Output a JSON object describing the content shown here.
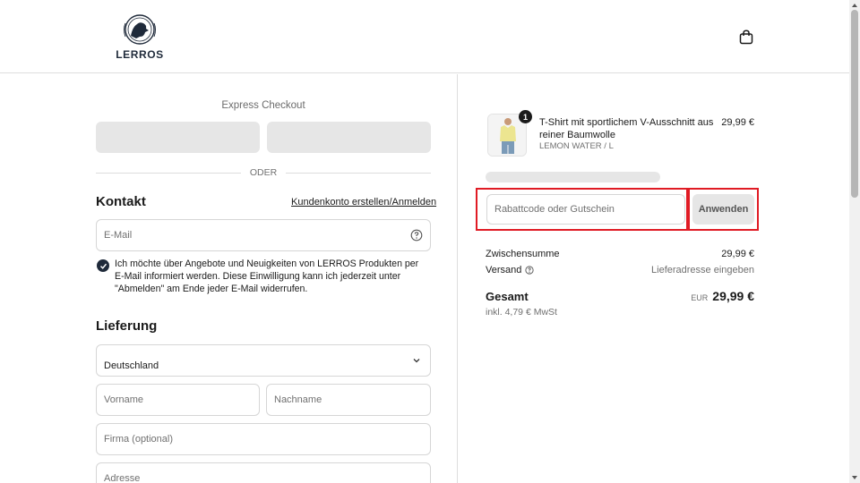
{
  "header": {
    "logo_text": "LERROS",
    "cart_icon": "shopping-bag-icon"
  },
  "express": {
    "label": "Express Checkout",
    "separator": "ODER"
  },
  "contact": {
    "title": "Kontakt",
    "login_link": "Kundenkonto erstellen/Anmelden",
    "email_placeholder": "E-Mail",
    "consent_checked": true,
    "consent_text": "Ich möchte über Angebote und Neuigkeiten von LERROS Produkten per E-Mail informiert werden. Diese Einwilligung kann ich jederzeit unter \"Abmelden\" am Ende jeder E-Mail widerrufen."
  },
  "delivery": {
    "title": "Lieferung",
    "country_value": "Deutschland",
    "first_name_placeholder": "Vorname",
    "last_name_placeholder": "Nachname",
    "company_placeholder": "Firma (optional)",
    "address_placeholder": "Adresse"
  },
  "order": {
    "item": {
      "quantity": "1",
      "name": "T-Shirt mit sportlichem V-Ausschnitt aus reiner Baumwolle",
      "variant": "LEMON WATER / L",
      "price": "29,99 €"
    },
    "discount_placeholder": "Rabattcode oder Gutschein",
    "apply_label": "Anwenden",
    "subtotal_label": "Zwischensumme",
    "subtotal_value": "29,99 €",
    "shipping_label": "Versand",
    "shipping_value": "Lieferadresse eingeben",
    "total_label": "Gesamt",
    "total_currency": "EUR",
    "total_value": "29,99 €",
    "tax_note": "inkl. 4,79 € MwSt"
  },
  "colors": {
    "brand": "#1f2a3a",
    "highlight": "#e01b24"
  }
}
